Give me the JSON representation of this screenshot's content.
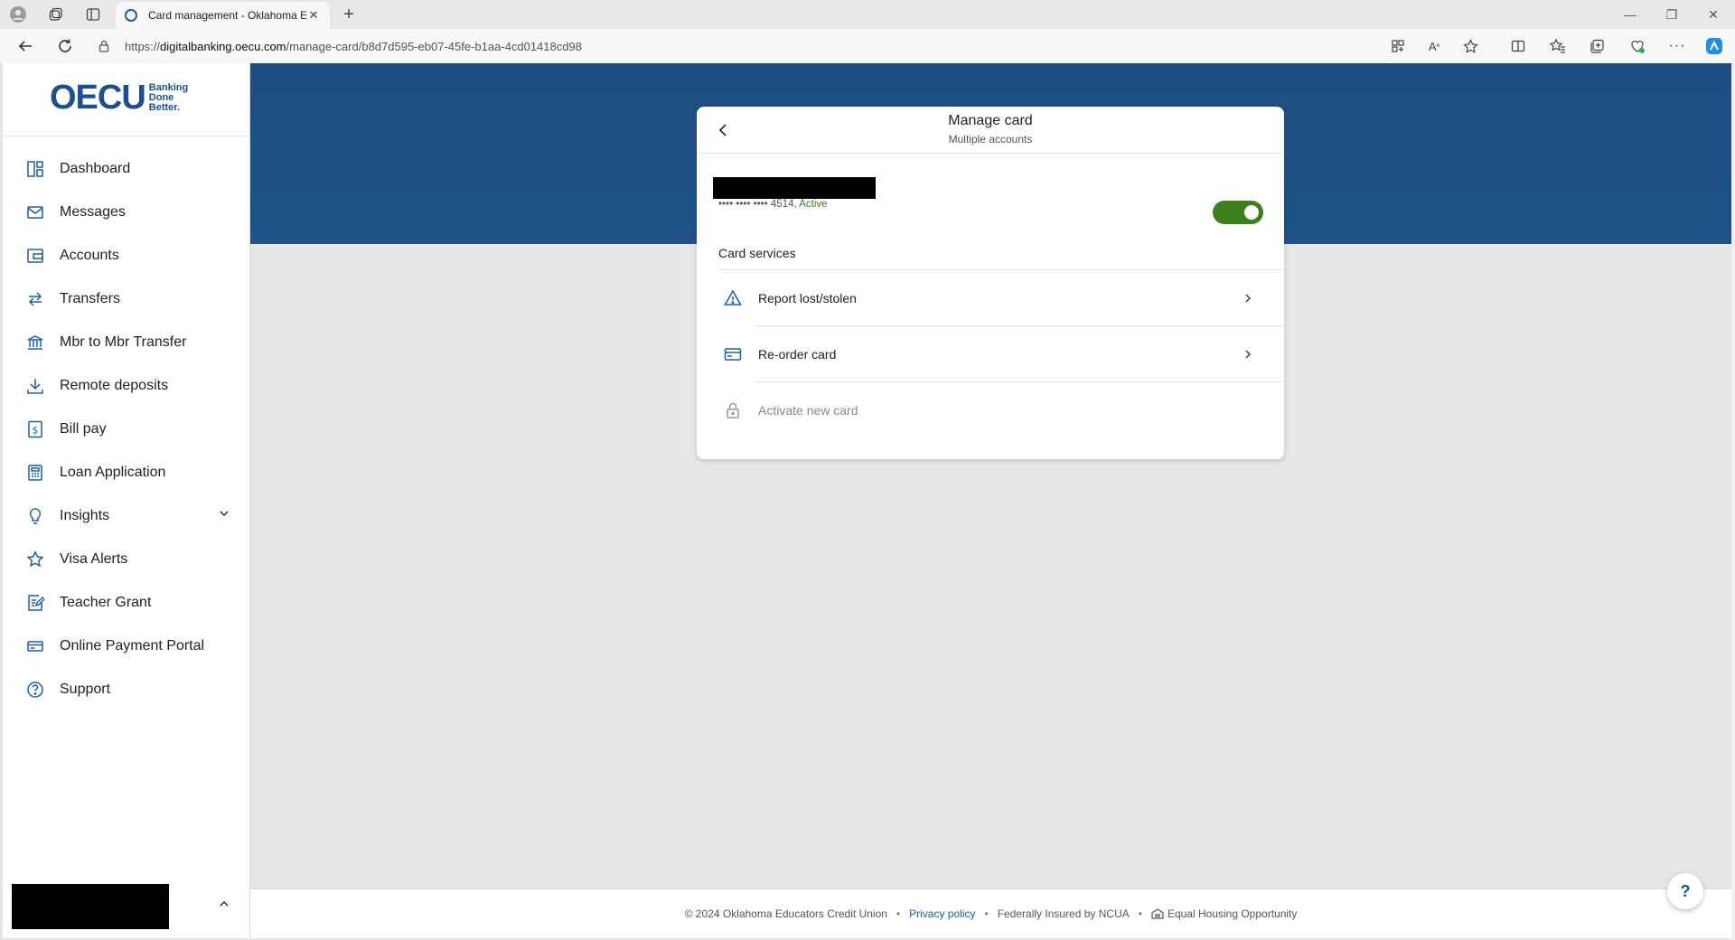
{
  "browser": {
    "tab_title": "Card management - Oklahoma E",
    "url_prefix": "https://",
    "url_domain": "digitalbanking.oecu.com",
    "url_path": "/manage-card/b8d7d595-eb07-45fe-b1aa-4cd01418cd98"
  },
  "sidebar": {
    "logo_text": "OECU",
    "logo_tagline": [
      "Banking",
      "Done",
      "Better."
    ],
    "items": [
      {
        "label": "Dashboard",
        "icon": "dashboard-icon"
      },
      {
        "label": "Messages",
        "icon": "mail-icon"
      },
      {
        "label": "Accounts",
        "icon": "wallet-icon"
      },
      {
        "label": "Transfers",
        "icon": "transfer-icon"
      },
      {
        "label": "Mbr to Mbr Transfer",
        "icon": "bank-icon"
      },
      {
        "label": "Remote deposits",
        "icon": "download-icon"
      },
      {
        "label": "Bill pay",
        "icon": "bill-icon"
      },
      {
        "label": "Loan Application",
        "icon": "calculator-icon"
      },
      {
        "label": "Insights",
        "icon": "lightbulb-icon"
      },
      {
        "label": "Visa Alerts",
        "icon": "star-icon"
      },
      {
        "label": "Teacher Grant",
        "icon": "edit-icon"
      },
      {
        "label": "Online Payment Portal",
        "icon": "card-icon"
      },
      {
        "label": "Support",
        "icon": "help-circle-icon"
      }
    ]
  },
  "card": {
    "title": "Manage card",
    "subtitle": "Multiple accounts",
    "number_masked": "•••• •••• •••• 4514, ",
    "status": "Active",
    "section_label": "Card services",
    "services": [
      {
        "label": "Report lost/stolen",
        "icon": "warning-icon"
      },
      {
        "label": "Re-order card",
        "icon": "credit-card-icon"
      },
      {
        "label": "Activate new card",
        "icon": "lock-icon"
      }
    ]
  },
  "footer": {
    "copyright": "© 2024 Oklahoma Educators Credit Union",
    "privacy": "Privacy policy",
    "insured": "Federally Insured by NCUA",
    "eho": "Equal Housing Opportunity"
  },
  "help_label": "?",
  "colors": {
    "brand_blue": "#1d4f8e",
    "banner": "#1e4d80",
    "toggle_on": "#3d7f1b",
    "active_text": "#3a7d1a"
  }
}
